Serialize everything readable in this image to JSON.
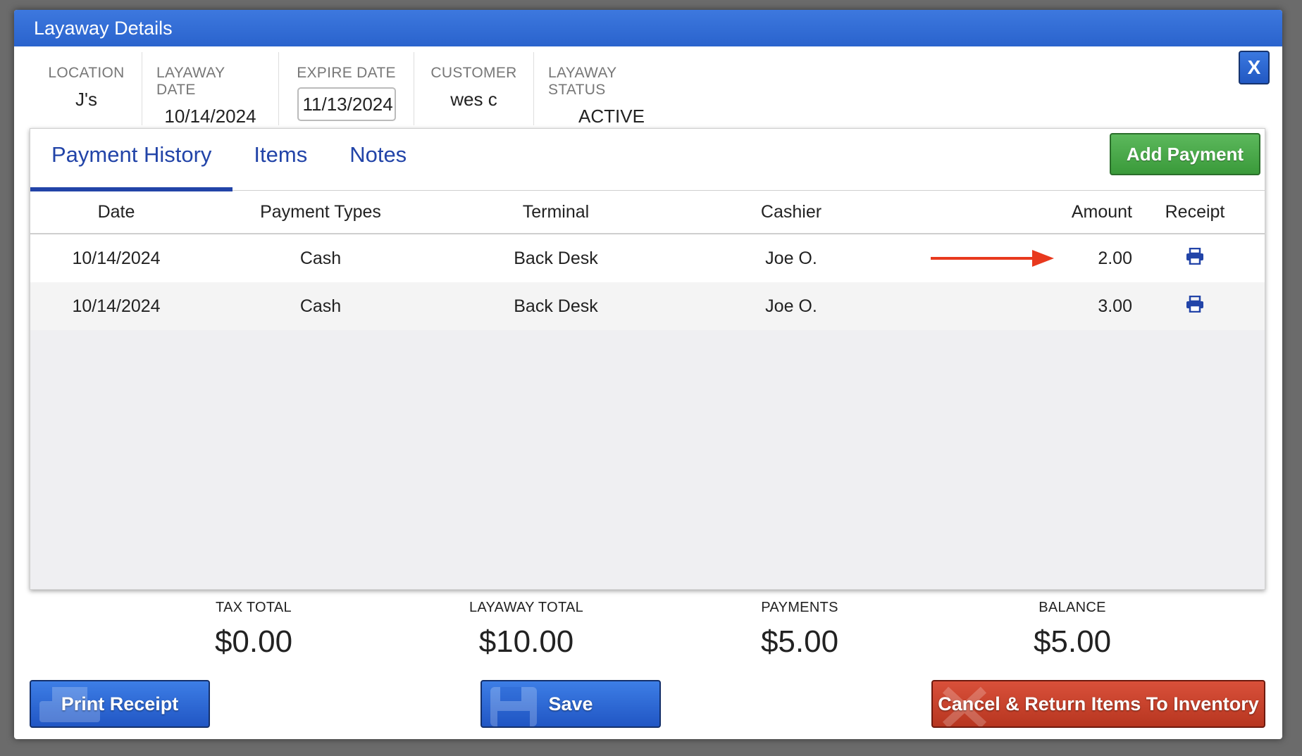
{
  "window": {
    "title": "Layaway Details",
    "close_label": "X"
  },
  "info": {
    "location": {
      "label": "LOCATION",
      "value": "J's"
    },
    "layaway_date": {
      "label": "LAYAWAY DATE",
      "value": "10/14/2024"
    },
    "expire_date": {
      "label": "EXPIRE DATE",
      "value": "11/13/2024"
    },
    "customer": {
      "label": "CUSTOMER",
      "value": "wes c"
    },
    "status": {
      "label": "LAYAWAY STATUS",
      "value": "ACTIVE"
    }
  },
  "tabs": [
    {
      "label": "Payment History",
      "active": true
    },
    {
      "label": "Items",
      "active": false
    },
    {
      "label": "Notes",
      "active": false
    }
  ],
  "add_payment_label": "Add Payment",
  "table": {
    "headers": {
      "date": "Date",
      "payment_types": "Payment Types",
      "terminal": "Terminal",
      "cashier": "Cashier",
      "amount": "Amount",
      "receipt": "Receipt"
    },
    "rows": [
      {
        "date": "10/14/2024",
        "payment_type": "Cash",
        "terminal": "Back Desk",
        "cashier": "Joe O.",
        "amount": "2.00"
      },
      {
        "date": "10/14/2024",
        "payment_type": "Cash",
        "terminal": "Back Desk",
        "cashier": "Joe O.",
        "amount": "3.00"
      }
    ]
  },
  "totals": {
    "tax_total": {
      "label": "TAX TOTAL",
      "value": "$0.00"
    },
    "layaway_total": {
      "label": "LAYAWAY TOTAL",
      "value": "$10.00"
    },
    "payments": {
      "label": "PAYMENTS",
      "value": "$5.00"
    },
    "balance": {
      "label": "BALANCE",
      "value": "$5.00"
    }
  },
  "buttons": {
    "print_receipt": "Print Receipt",
    "save": "Save",
    "cancel_return": "Cancel & Return Items To Inventory"
  },
  "colors": {
    "header_blue": "#2a63cd",
    "tab_blue": "#2244a8",
    "green": "#3a9a3a",
    "red": "#b73620",
    "arrow_red": "#e8391e"
  },
  "icons": {
    "receipt": "printer-icon",
    "annotation": "red-arrow-icon"
  }
}
